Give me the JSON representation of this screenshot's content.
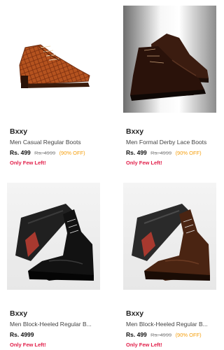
{
  "products": [
    {
      "brand": "Bxxy",
      "title": "Men Casual Regular Boots",
      "price": "Rs. 499",
      "mrp": "Rs. 4999",
      "discount": "(90% OFF)",
      "stock": "Only Few Left!",
      "image": "brown-croc-boot"
    },
    {
      "brand": "Bxxy",
      "title": "Men Formal Derby Lace Boots",
      "price": "Rs. 499",
      "mrp": "Rs. 4999",
      "discount": "(90% OFF)",
      "stock": "Only Few Left!",
      "image": "dark-brown-derby-boots"
    },
    {
      "brand": "Bxxy",
      "title": "Men Block-Heeled Regular B...",
      "price": "Rs. 4999",
      "mrp": "",
      "discount": "",
      "stock": "Only Few Left!",
      "image": "black-heeled-boots"
    },
    {
      "brand": "Bxxy",
      "title": "Men Block-Heeled Regular B...",
      "price": "Rs. 499",
      "mrp": "Rs. 4999",
      "discount": "(90% OFF)",
      "stock": "Only Few Left!",
      "image": "brown-heeled-boots"
    }
  ],
  "colors": {
    "discount": "#f59e0b",
    "stock": "#e11d48",
    "croc": "#b5531f",
    "black_leather": "#121212",
    "brown_leather": "#4a2412",
    "sole_red": "#a8392f"
  }
}
